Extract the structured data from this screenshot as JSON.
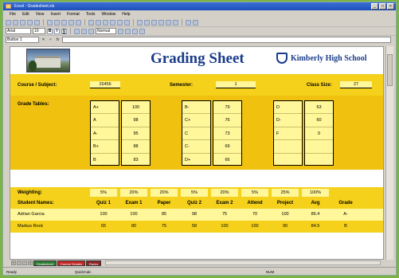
{
  "window": {
    "title": "Excel - Gradesheet.xls"
  },
  "menu": [
    "File",
    "Edit",
    "View",
    "Insert",
    "Format",
    "Tools",
    "Window",
    "Help"
  ],
  "toolbar": {
    "font_name": "Arial",
    "font_size": "10",
    "zoom": "Normal"
  },
  "formula_bar": {
    "name_box": "Button 1"
  },
  "sheet": {
    "title": "Grading Sheet",
    "school": "Kimberly High School",
    "info": {
      "course_label": "Course / Subject:",
      "course_value": "15456",
      "semester_label": "Semester:",
      "semester_value": "1",
      "class_size_label": "Class Size:",
      "class_size_value": "27"
    },
    "grade_tables_label": "Grade Tables:",
    "grade_tables": [
      {
        "grades": [
          "A+",
          "A",
          "A-",
          "B+",
          "B"
        ],
        "mins": [
          "100",
          "98",
          "95",
          "88",
          "83"
        ]
      },
      {
        "grades": [
          "B-",
          "C+",
          "C",
          "C-",
          "D+"
        ],
        "mins": [
          "79",
          "76",
          "73",
          "69",
          "66"
        ]
      },
      {
        "grades": [
          "D",
          "D-",
          "F",
          "",
          ""
        ],
        "mins": [
          "63",
          "60",
          "0",
          "",
          ""
        ]
      }
    ],
    "weighting_label": "Weighting:",
    "weights": [
      "5%",
      "20%",
      "20%",
      "5%",
      "20%",
      "5%",
      "25%",
      "100%"
    ],
    "student_names_label": "Student Names:",
    "columns": [
      "Quiz 1",
      "Exam 1",
      "Paper",
      "Quiz 2",
      "Exam 2",
      "Attend",
      "Project",
      "Avg",
      "Grade"
    ],
    "students": [
      {
        "name": "Adrian Garcia",
        "scores": [
          "100",
          "100",
          "85",
          "98",
          "75",
          "70",
          "100",
          "86.4",
          "A-"
        ]
      },
      {
        "name": "Markus Rock",
        "scores": [
          "65",
          "80",
          "75",
          "58",
          "100",
          "100",
          "90",
          "84.5",
          "B"
        ]
      }
    ]
  },
  "tabs": [
    "Gradesheet",
    "Course Grades",
    "Ranks"
  ],
  "tab_colors": [
    "#2e7d32",
    "#c62828",
    "#8e2424"
  ],
  "status": {
    "ready": "Ready",
    "mode": "NUM",
    "cell": "QuickCalc"
  }
}
